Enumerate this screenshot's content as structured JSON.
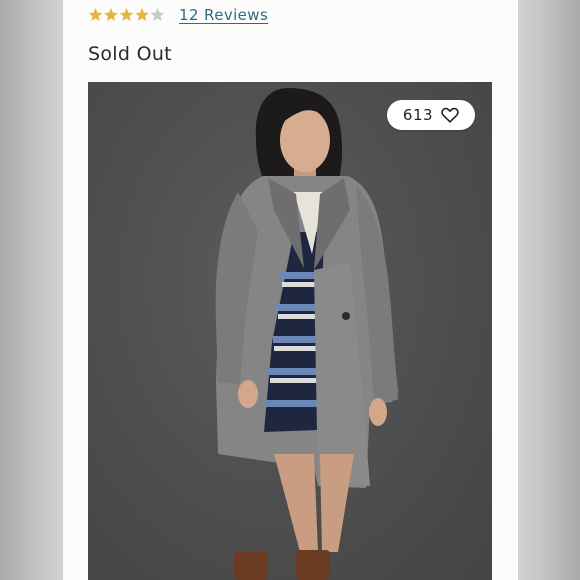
{
  "product": {
    "rating": 4.5,
    "rating_max": 5,
    "star_color": "#e5b63b",
    "reviews_label": "12 Reviews",
    "status": "Sold Out"
  },
  "photo": {
    "like_count": "613",
    "like_icon": "heart-outline-icon",
    "subject": "model-in-grey-coat"
  }
}
